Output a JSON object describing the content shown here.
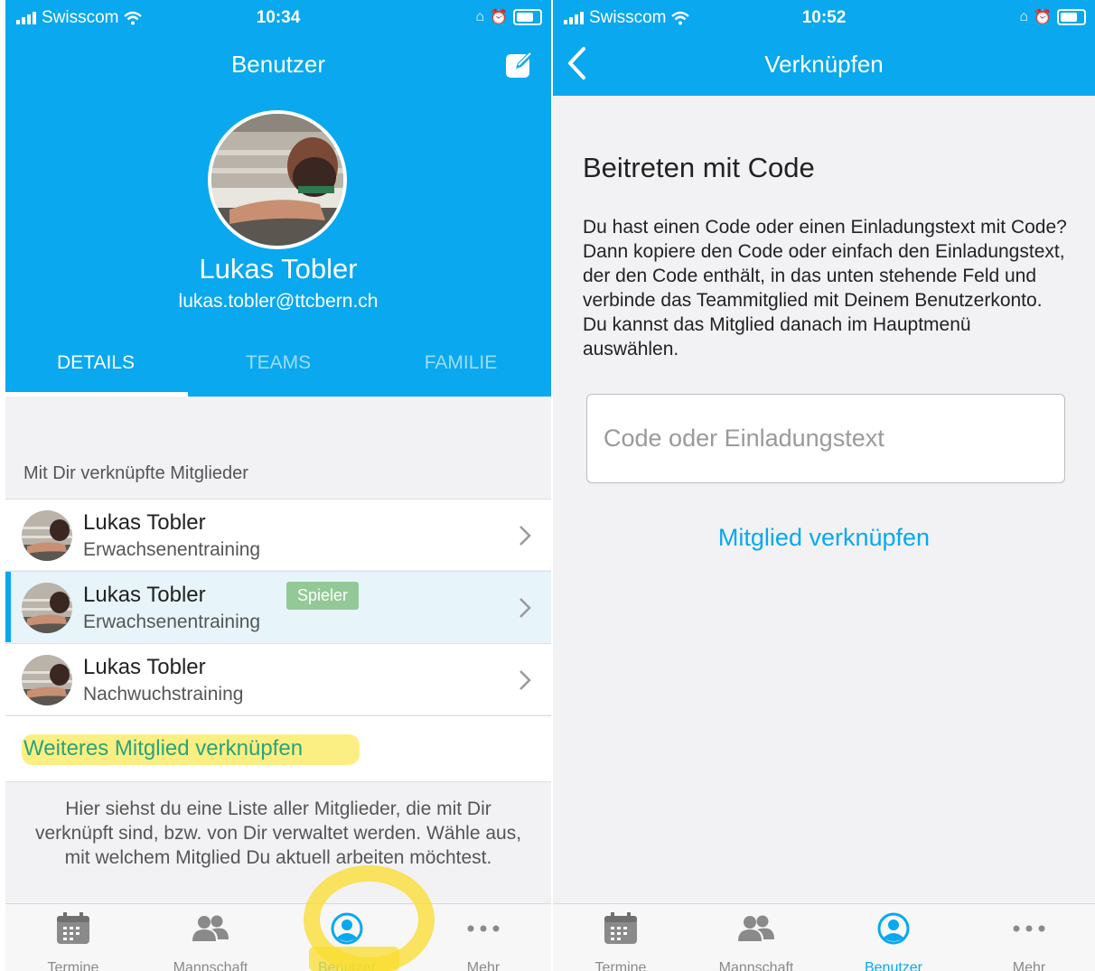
{
  "left": {
    "status": {
      "carrier": "Swisscom",
      "time": "10:34"
    },
    "nav_title": "Benutzer",
    "profile": {
      "name": "Lukas Tobler",
      "email": "lukas.tobler@ttcbern.ch"
    },
    "tabs": [
      {
        "label": "DETAILS",
        "active": true
      },
      {
        "label": "TEAMS",
        "active": false
      },
      {
        "label": "FAMILIE",
        "active": false
      }
    ],
    "section_title": "Mit Dir verknüpfte Mitglieder",
    "members": [
      {
        "name": "Lukas Tobler",
        "team": "Erwachsenentraining",
        "badge": "",
        "selected": false
      },
      {
        "name": "Lukas Tobler",
        "team": "Erwachsenentraining",
        "badge": "Spieler",
        "selected": true
      },
      {
        "name": "Lukas Tobler",
        "team": "Nachwuchstraining",
        "badge": "",
        "selected": false
      }
    ],
    "link_more": "Weiteres Mitglied verknüpfen",
    "help_text": "Hier siehst du eine Liste aller Mitglieder, die mit Dir verknüpft sind, bzw. von Dir verwaltet werden. Wähle aus, mit welchem Mitglied Du aktuell arbeiten möchtest."
  },
  "right": {
    "status": {
      "carrier": "Swisscom",
      "time": "10:52"
    },
    "nav_title": "Verknüpfen",
    "heading": "Beitreten mit Code",
    "body": "Du hast einen Code oder einen Einladungstext mit Code? Dann kopiere den Code oder einfach den Einladungstext, der den Code enthält, in das unten stehende Feld und verbinde das Teammitglied mit Deinem Benutzerkonto. Du kannst das Mitglied danach im Hauptmenü auswählen.",
    "input": {
      "placeholder": "Code oder Einladungstext",
      "value": ""
    },
    "button": "Mitglied verknüpfen"
  },
  "tabbar": {
    "items": [
      {
        "label": "Termine",
        "icon": "calendar-icon"
      },
      {
        "label": "Mannschaft",
        "icon": "people-icon"
      },
      {
        "label": "Benutzer",
        "icon": "user-circle-icon"
      },
      {
        "label": "Mehr",
        "icon": "more-icon"
      }
    ],
    "active": "Benutzer"
  },
  "colors": {
    "primary": "#09a8ef",
    "badge": "#93c996",
    "link_green": "#2aa37a",
    "annotation_yellow": "#f9dc2c"
  }
}
